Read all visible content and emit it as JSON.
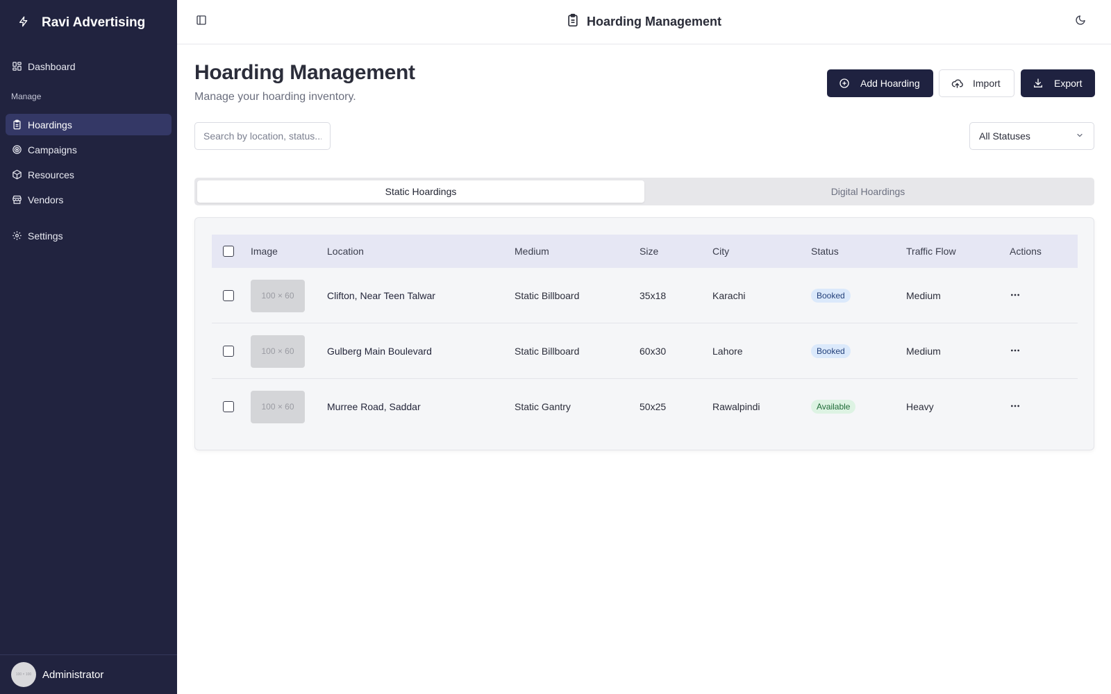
{
  "app": {
    "brand": "Ravi Advertising"
  },
  "sidebar": {
    "items": [
      {
        "label": "Dashboard",
        "icon": "dashboard-icon"
      },
      {
        "label": "Hoardings",
        "icon": "clipboard-icon",
        "active": true
      },
      {
        "label": "Campaigns",
        "icon": "target-icon"
      },
      {
        "label": "Resources",
        "icon": "box-icon"
      },
      {
        "label": "Vendors",
        "icon": "store-icon"
      },
      {
        "label": "Settings",
        "icon": "gear-icon"
      }
    ],
    "section_label": "Manage",
    "user": {
      "name": "Administrator",
      "avatar_text": "100 × 100"
    }
  },
  "topbar": {
    "title": "Hoarding Management"
  },
  "page": {
    "title": "Hoarding Management",
    "subtitle": "Manage your hoarding inventory.",
    "buttons": {
      "add": "Add Hoarding",
      "import": "Import",
      "export": "Export"
    },
    "search": {
      "placeholder": "Search by location, status..."
    },
    "status_filter": {
      "value": "All Statuses"
    },
    "tabs": [
      {
        "label": "Static Hoardings",
        "active": true
      },
      {
        "label": "Digital Hoardings",
        "active": false
      }
    ]
  },
  "table": {
    "columns": [
      "Image",
      "Location",
      "Medium",
      "Size",
      "City",
      "Status",
      "Traffic Flow",
      "Actions"
    ],
    "rows": [
      {
        "image": "100 × 60",
        "location": "Clifton, Near Teen Talwar",
        "medium": "Static Billboard",
        "size": "35x18",
        "city": "Karachi",
        "status": "Booked",
        "traffic": "Medium"
      },
      {
        "image": "100 × 60",
        "location": "Gulberg Main Boulevard",
        "medium": "Static Billboard",
        "size": "60x30",
        "city": "Lahore",
        "status": "Booked",
        "traffic": "Medium"
      },
      {
        "image": "100 × 60",
        "location": "Murree Road, Saddar",
        "medium": "Static Gantry",
        "size": "50x25",
        "city": "Rawalpindi",
        "status": "Available",
        "traffic": "Heavy"
      }
    ]
  },
  "colors": {
    "sidebar_bg": "#21233f",
    "sidebar_active": "#343866",
    "primary_button": "#1f2240",
    "booked_badge": "#dbe9fb",
    "available_badge": "#ddf3e3"
  }
}
